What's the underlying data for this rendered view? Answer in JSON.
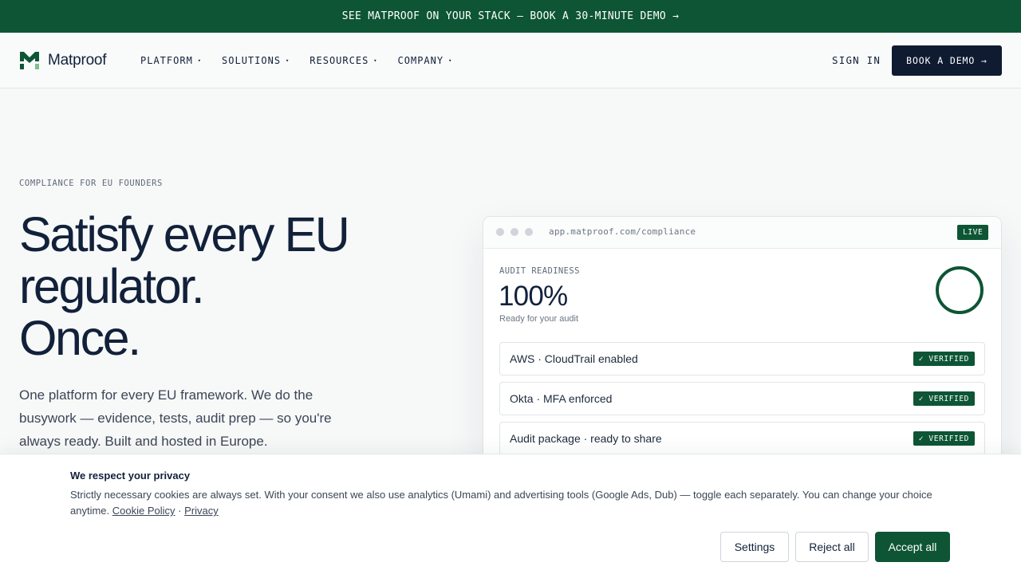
{
  "announcement": {
    "text": "SEE MATPROOF ON YOUR STACK — BOOK A 30-MINUTE DEMO →"
  },
  "nav": {
    "brand": "Matproof",
    "items": [
      {
        "label": "PLATFORM"
      },
      {
        "label": "SOLUTIONS"
      },
      {
        "label": "RESOURCES"
      },
      {
        "label": "COMPANY"
      }
    ],
    "caret": "▾",
    "sign_in": "SIGN IN",
    "book_demo": "BOOK A DEMO →"
  },
  "hero": {
    "eyebrow": "COMPLIANCE FOR EU FOUNDERS",
    "headline_lines": [
      "Satisfy every EU",
      "regulator.",
      "Once."
    ],
    "lede": "One platform for every EU framework. We do the busywork — evidence, tests, audit prep — so you're always ready. Built and hosted in Europe."
  },
  "preview": {
    "url": "app.matproof.com/compliance",
    "live_badge": "LIVE",
    "readiness_label": "AUDIT READINESS",
    "readiness_value": "100%",
    "readiness_fraction": 1.0,
    "readiness_sub": "Ready for your audit",
    "checks": [
      {
        "label": "AWS · CloudTrail enabled",
        "status": "✓ VERIFIED"
      },
      {
        "label": "Okta · MFA enforced",
        "status": "✓ VERIFIED"
      },
      {
        "label": "Audit package · ready to share",
        "status": "✓ VERIFIED"
      }
    ]
  },
  "cookie": {
    "title": "We respect your privacy",
    "text": "Strictly necessary cookies are always set. With your consent we also use analytics (Umami) and advertising tools (Google Ads, Dub) — toggle each separately. You can change your choice anytime.",
    "cookie_policy_link": "Cookie Policy",
    "separator": " · ",
    "privacy_link": "Privacy",
    "settings": "Settings",
    "reject": "Reject all",
    "accept": "Accept all"
  },
  "colors": {
    "brand_green": "#0d5535",
    "navy": "#0f1b31",
    "logo_light_green": "#7fbf8f"
  },
  "icons": {
    "logo": "matproof-logo-icon",
    "window_dots": "window-controls-icon",
    "readiness": "progress-ring-icon"
  }
}
